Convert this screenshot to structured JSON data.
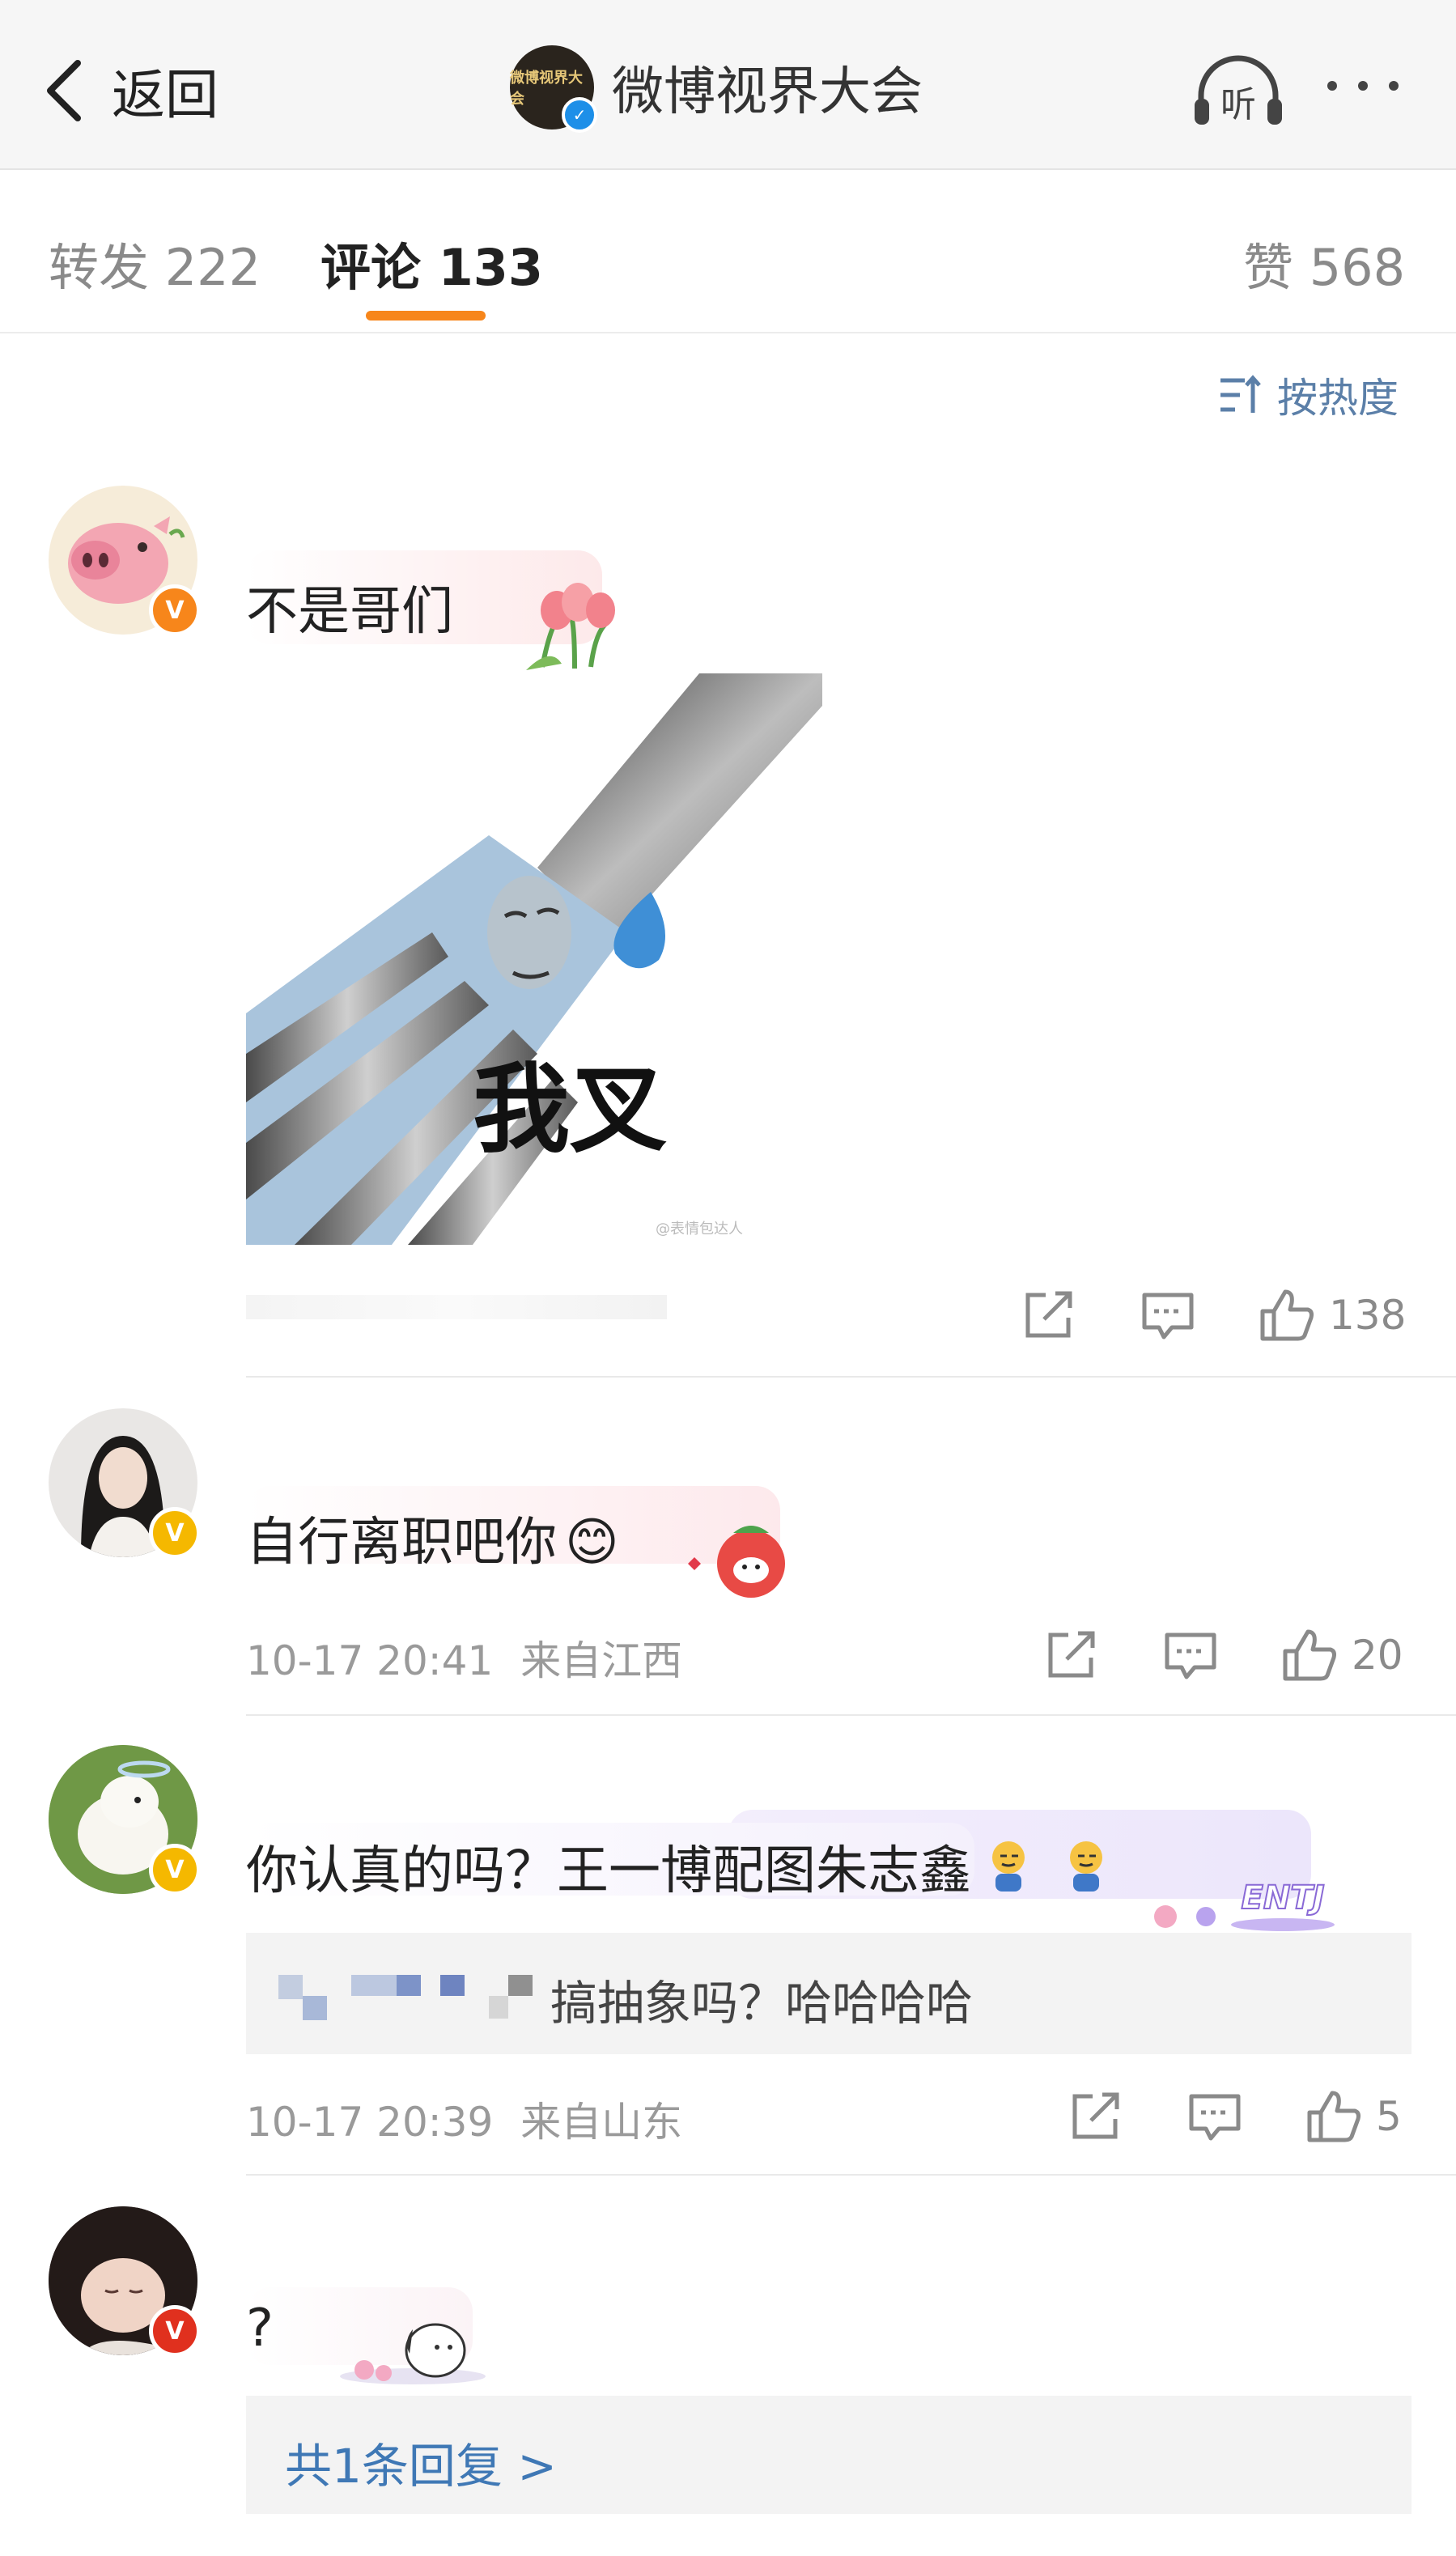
{
  "header": {
    "back_label": "返回",
    "title": "微博视界大会",
    "avatar_text": "微博视界大会",
    "listen_label": "听"
  },
  "tabs": {
    "repost_label": "转发",
    "repost_count": "222",
    "comment_label": "评论",
    "comment_count": "133",
    "like_label": "赞",
    "like_count": "568"
  },
  "sort": {
    "label": "按热度"
  },
  "comments": [
    {
      "text": "不是哥们",
      "sticker_text": "我叉",
      "watermark": "@表情包达人",
      "like_count": "138",
      "badge": "V"
    },
    {
      "text": "自行离职吧你",
      "emoji": "😊",
      "time": "10-17 20:41",
      "location": "来自江西",
      "like_count": "20",
      "badge": "V"
    },
    {
      "text": "你认真的吗？王一博配图朱志鑫",
      "decor_text": "ENTJ",
      "quote_text": "搞抽象吗？哈哈哈哈",
      "time": "10-17 20:39",
      "location": "来自山东",
      "like_count": "5",
      "badge": "V"
    },
    {
      "text": "?",
      "reply_text": "共1条回复 >",
      "badge": "V"
    }
  ],
  "colors": {
    "accent": "#f7861b",
    "link": "#3f78b5",
    "sort": "#5b7fa8"
  }
}
